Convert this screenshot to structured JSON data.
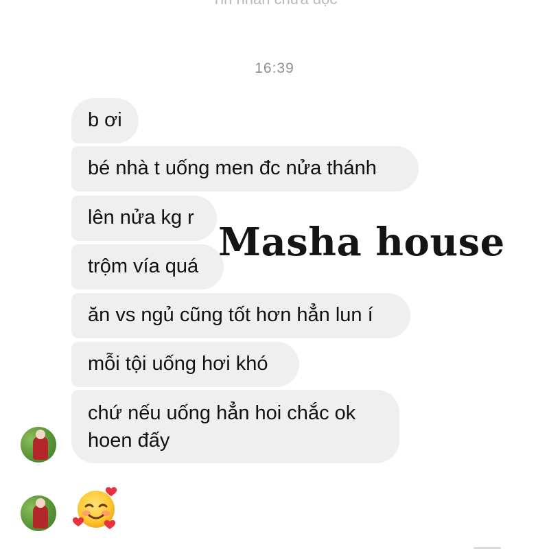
{
  "header": {
    "partial_text": "Tin nhắn chưa đọc"
  },
  "timestamp": "16:39",
  "messages": [
    "b ơi",
    "bé nhà t uống men đc nửa thánh",
    "lên nửa kg r",
    "trộm vía quá",
    "ăn vs ngủ cũng tốt hơn hẳn lun í",
    "mỗi tội uống hơi khó",
    "chứ nếu uống hẳn hoi chắc ok hoen đấy"
  ],
  "reaction": {
    "icon": "smiling-face-with-hearts-icon"
  },
  "watermark": "Masha house",
  "colors": {
    "bubble": "#efeff0",
    "text": "#111111",
    "timestamp": "#8e8e93"
  }
}
